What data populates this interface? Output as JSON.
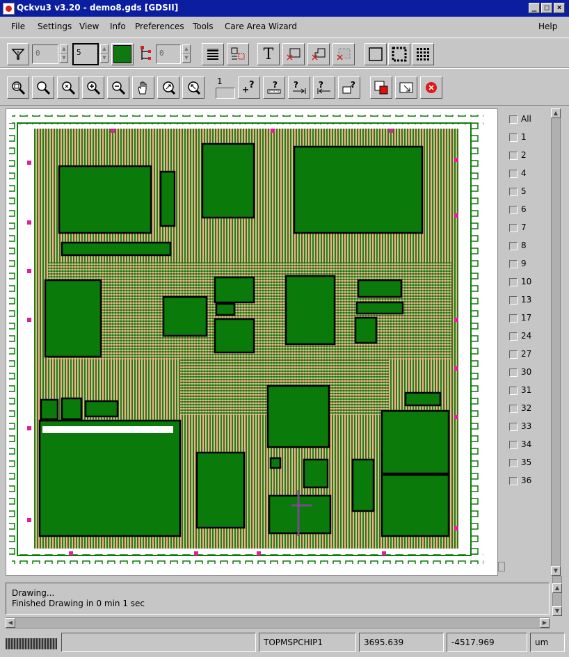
{
  "window": {
    "title": "Qckvu3 v3.20 - demo8.gds [GDSII]",
    "buttons": {
      "minimize": "_",
      "maximize": "□",
      "close": "×"
    }
  },
  "menu": {
    "file": "File",
    "settings": "Settings",
    "view": "View",
    "info": "Info",
    "preferences": "Preferences",
    "tools": "Tools",
    "care_area_wizard": "Care Area Wizard",
    "help": "Help"
  },
  "toolbar1": {
    "filter_icon": "funnel-icon",
    "level_from": "0",
    "level_to": "5",
    "fill_color": "#107810",
    "hier_icon": "hierarchy-icon",
    "hier_depth": "0",
    "text_label": "T"
  },
  "toolbar2": {
    "zoom_level": "1",
    "icons": [
      "zoom-all-icon",
      "zoom-window-icon",
      "zoom-fit-icon",
      "zoom-in-icon",
      "zoom-out-icon",
      "pan-hand-icon",
      "zoom-center-icon",
      "zoom-previous-icon",
      "measure-icon",
      "query-point-icon",
      "query-ruler-icon",
      "query-next-icon",
      "query-prev-icon",
      "query-box-icon",
      "export-icon",
      "snapshot-icon",
      "stop-icon"
    ]
  },
  "layers": {
    "items": [
      "All",
      "1",
      "2",
      "4",
      "5",
      "6",
      "7",
      "8",
      "9",
      "10",
      "13",
      "17",
      "24",
      "27",
      "30",
      "31",
      "32",
      "33",
      "34",
      "35",
      "36"
    ]
  },
  "messages": {
    "line1": "Drawing...",
    "line2": "Finished Drawing in 0 min 1 sec"
  },
  "status": {
    "blank": "",
    "cell": "TOPMSPCHIP1",
    "x": "3695.639",
    "y": "-4517.969",
    "units": "um"
  },
  "colors": {
    "layout_green": "#0a7a0a",
    "layout_salmon": "#f0b090",
    "pad_magenta": "#e0209a",
    "title_blue": "#0c1ea0"
  }
}
